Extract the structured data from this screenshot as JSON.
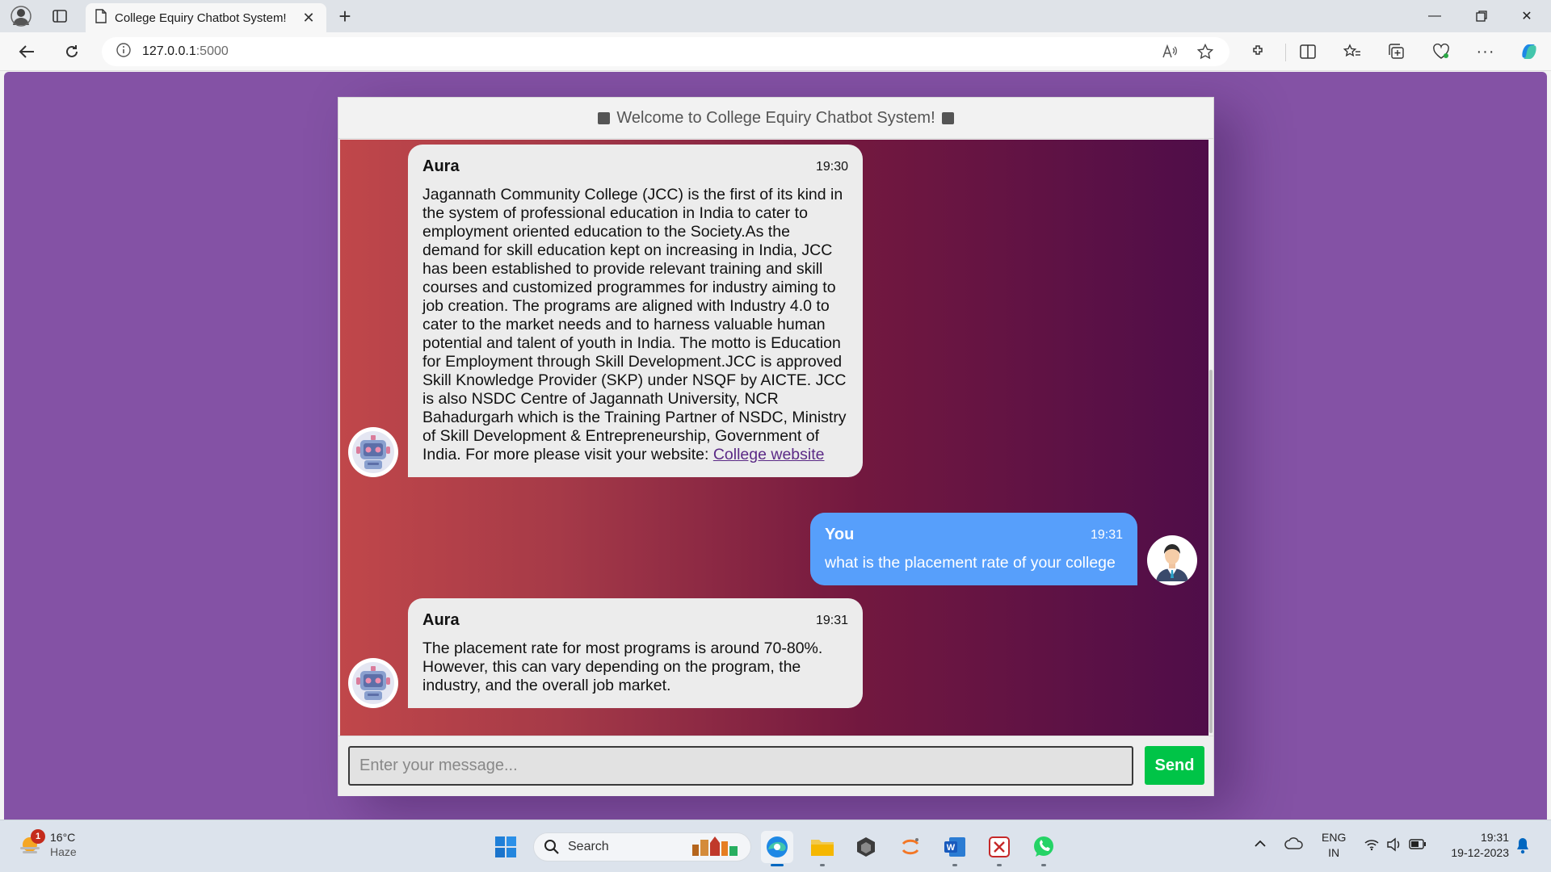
{
  "browser": {
    "tab_title": "College Equiry Chatbot System!",
    "url_host": "127.0.0.1",
    "url_port": ":5000"
  },
  "chat": {
    "header_title": "Welcome to College Equiry Chatbot System!",
    "messages": [
      {
        "sender": "Aura",
        "time": "19:30",
        "text": "Jagannath Community College (JCC) is the first of its kind in the system of professional education in India to cater to employment oriented education to the Society.As the demand for skill education kept on increasing in India, JCC has been established to provide relevant training and skill courses and customized programmes for industry aiming to job creation. The programs are aligned with Industry 4.0 to cater to the market needs and to harness valuable human potential and talent of youth in India. The motto is Education for Employment through Skill Development.JCC is approved Skill Knowledge Provider (SKP) under NSQF by AICTE. JCC is also NSDC Centre of Jagannath University, NCR Bahadurgarh which is the Training Partner of NSDC, Ministry of Skill Development & Entrepreneurship, Government of India. For more please visit your website: ",
        "link_text": "College website"
      },
      {
        "sender": "You",
        "time": "19:31",
        "text": "what is the placement rate of your college"
      },
      {
        "sender": "Aura",
        "time": "19:31",
        "text": "The placement rate for most programs is around 70-80%. However, this can vary depending on the program, the industry, and the overall job market."
      }
    ],
    "input_placeholder": "Enter your message...",
    "send_label": "Send"
  },
  "taskbar": {
    "weather_temp": "16°C",
    "weather_desc": "Haze",
    "weather_badge": "1",
    "search_label": "Search",
    "lang_top": "ENG",
    "lang_bottom": "IN",
    "time": "19:31",
    "date": "19-12-2023"
  },
  "colors": {
    "page_bg": "#8452a5",
    "user_bubble": "#579ffb",
    "bot_bubble": "#ececec",
    "send_button": "#00c447"
  }
}
